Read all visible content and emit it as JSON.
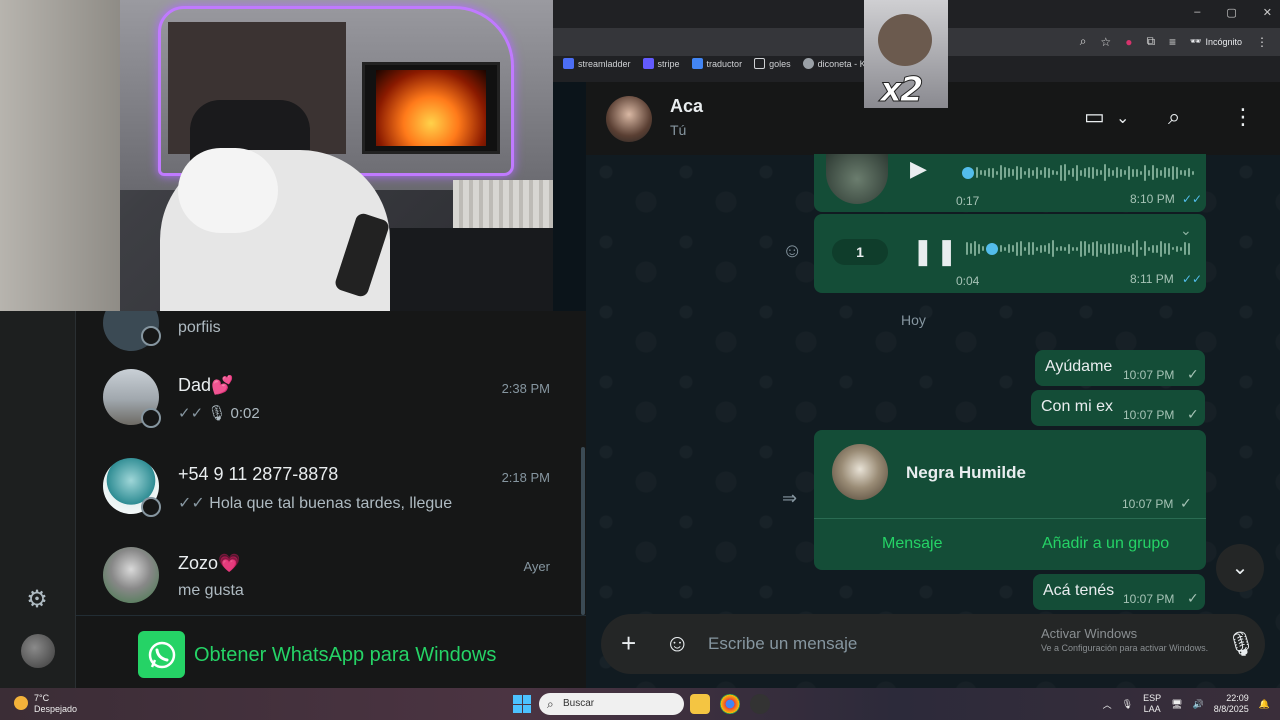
{
  "browser": {
    "incognito_label": "Incógnito",
    "bookmarks": [
      {
        "label": "streamladder",
        "icon": "SL"
      },
      {
        "label": "stripe",
        "icon": "S"
      },
      {
        "label": "traductor",
        "icon": "G"
      },
      {
        "label": "goles",
        "icon": "folder"
      },
      {
        "label": "diconeta - Kick St",
        "icon": "kick"
      }
    ],
    "window_controls": [
      "–",
      "▢",
      "✕"
    ]
  },
  "overlay": {
    "x2_text": "x2"
  },
  "chat_list": {
    "items": [
      {
        "name": "",
        "time": "",
        "preview": "porfiis"
      },
      {
        "name": "Dad💕",
        "time": "2:38 PM",
        "preview": "0:02",
        "ticks": "✓✓"
      },
      {
        "name": "+54 9 11 2877-8878",
        "time": "2:18 PM",
        "preview": "Hola que tal buenas tardes, llegue",
        "ticks": "✓✓"
      },
      {
        "name": "Zozo💗",
        "time": "Ayer",
        "preview": "me gusta"
      }
    ],
    "get_windows_label": "Obtener WhatsApp para Windows"
  },
  "conversation": {
    "contact_name": "Aca",
    "contact_sub": "Tú",
    "voice_messages": [
      {
        "duration": "0:17",
        "time": "8:10 PM",
        "ticks": "✓✓"
      },
      {
        "speed": "1",
        "duration": "0:04",
        "time": "8:11 PM",
        "ticks": "✓✓"
      }
    ],
    "day_label": "Hoy",
    "messages": [
      {
        "text": "Ayúdame",
        "time": "10:07 PM",
        "tick": "✓"
      },
      {
        "text": "Con mi ex",
        "time": "10:07 PM",
        "tick": "✓"
      },
      {
        "text": "Acá tenés",
        "time": "10:07 PM",
        "tick": "✓"
      }
    ],
    "contact_card": {
      "name": "Negra Humilde",
      "time": "10:07 PM",
      "tick": "✓",
      "action_message": "Mensaje",
      "action_add_group": "Añadir a un grupo"
    },
    "input_placeholder": "Escribe un mensaje",
    "activate_windows_title": "Activar Windows",
    "activate_windows_sub": "Ve a Configuración para activar Windows."
  },
  "taskbar": {
    "weather_temp": "7°C",
    "weather_desc": "Despejado",
    "search_placeholder": "Buscar",
    "lang_top": "ESP",
    "lang_bottom": "LAA",
    "time": "22:09",
    "date": "8/8/2025"
  },
  "colors": {
    "accent": "#25d366",
    "bubble": "#144d37",
    "read_tick": "#53bdeb"
  }
}
